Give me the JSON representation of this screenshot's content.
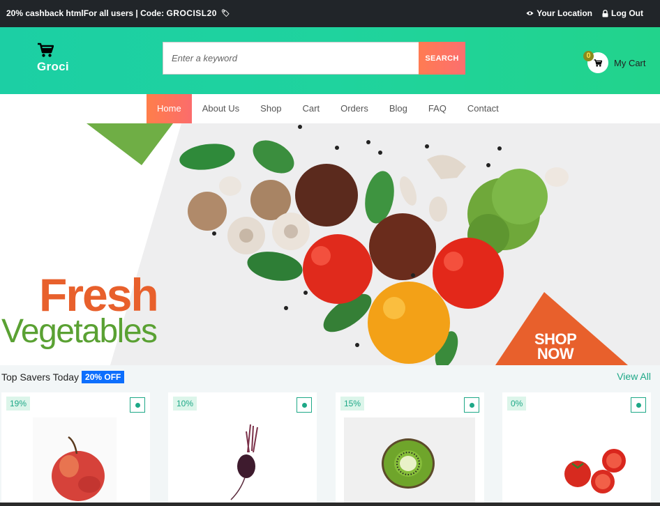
{
  "topbar": {
    "promo_text": "20% cashback htmlFor all users | Code: ",
    "promo_code": "GROCISL20",
    "location_label": "Your Location",
    "logout_label": "Log Out"
  },
  "header": {
    "logo_text": "Groci",
    "search_placeholder": "Enter a keyword",
    "search_value": "",
    "search_button": "SEARCH",
    "cart_count": "0",
    "cart_label": "My Cart"
  },
  "nav": {
    "items": [
      {
        "label": "Home",
        "active": true
      },
      {
        "label": "About Us"
      },
      {
        "label": "Shop"
      },
      {
        "label": "Cart"
      },
      {
        "label": "Orders"
      },
      {
        "label": "Blog"
      },
      {
        "label": "FAQ"
      },
      {
        "label": "Contact"
      }
    ]
  },
  "banner": {
    "line1": "Fresh",
    "line2": "Vegetables",
    "cta_line1": "SHOP",
    "cta_line2": "NOW"
  },
  "savers": {
    "title": "Top Savers Today",
    "badge": "20% OFF",
    "view_all": "View All",
    "products": [
      {
        "discount": "19%",
        "image": "apple"
      },
      {
        "discount": "10%",
        "image": "beetroot"
      },
      {
        "discount": "15%",
        "image": "kiwi"
      },
      {
        "discount": "0%",
        "image": "tomatoes"
      }
    ]
  },
  "colors": {
    "header_green": "#1fd39e",
    "accent_orange": "#ff7b52",
    "brand_teal": "#1ea887",
    "topbar_dark": "#212529",
    "offer_blue": "#0d6efd"
  }
}
